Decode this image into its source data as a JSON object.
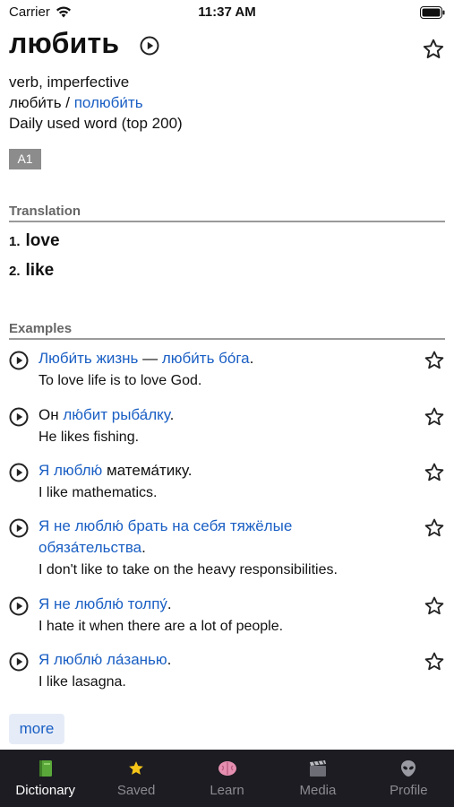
{
  "status_bar": {
    "carrier": "Carrier",
    "time": "11:37 AM"
  },
  "word": {
    "title": "любить",
    "part_of_speech": "verb, imperfective",
    "aspect_self": "люби́ть",
    "aspect_separator": " / ",
    "aspect_pair": "полюби́ть",
    "frequency": "Daily used word (top 200)",
    "level": "A1"
  },
  "translation": {
    "header": "Translation",
    "items": [
      {
        "num": "1.",
        "text": "love"
      },
      {
        "num": "2.",
        "text": "like"
      }
    ]
  },
  "examples": {
    "header": "Examples",
    "items": [
      {
        "parts": [
          {
            "t": "Люби́ть жизнь",
            "hl": true
          },
          {
            "t": " — ",
            "hl": false
          },
          {
            "t": "люби́ть бо́га",
            "hl": true
          },
          {
            "t": ".",
            "hl": false
          }
        ],
        "en": "To love life is to love God."
      },
      {
        "parts": [
          {
            "t": "Он ",
            "hl": false
          },
          {
            "t": "лю́бит рыба́лку",
            "hl": true
          },
          {
            "t": ".",
            "hl": false
          }
        ],
        "en": "He likes fishing."
      },
      {
        "parts": [
          {
            "t": "Я люблю́",
            "hl": true
          },
          {
            "t": " матема́тику.",
            "hl": false
          }
        ],
        "en": "I like mathematics."
      },
      {
        "parts": [
          {
            "t": "Я не люблю́ брать на себя тяжёлые обяза́тельства",
            "hl": true
          },
          {
            "t": ".",
            "hl": false
          }
        ],
        "en": "I don't like to take on the heavy responsibilities."
      },
      {
        "parts": [
          {
            "t": "Я не люблю́ толпу́",
            "hl": true
          },
          {
            "t": ".",
            "hl": false
          }
        ],
        "en": "I hate it when there are a lot of people."
      },
      {
        "parts": [
          {
            "t": "Я люблю́ ла́занью",
            "hl": true
          },
          {
            "t": ".",
            "hl": false
          }
        ],
        "en": "I like lasagna."
      }
    ],
    "more_label": "more"
  },
  "tabbar": {
    "tabs": [
      {
        "label": "Dictionary",
        "icon": "book-icon",
        "active": true
      },
      {
        "label": "Saved",
        "icon": "star-icon",
        "active": false
      },
      {
        "label": "Learn",
        "icon": "brain-icon",
        "active": false
      },
      {
        "label": "Media",
        "icon": "clapper-icon",
        "active": false
      },
      {
        "label": "Profile",
        "icon": "alien-icon",
        "active": false
      }
    ]
  },
  "colors": {
    "link": "#1a5fc4",
    "tabbar_bg": "#1c1c22",
    "badge_bg": "#8c8c8c"
  }
}
